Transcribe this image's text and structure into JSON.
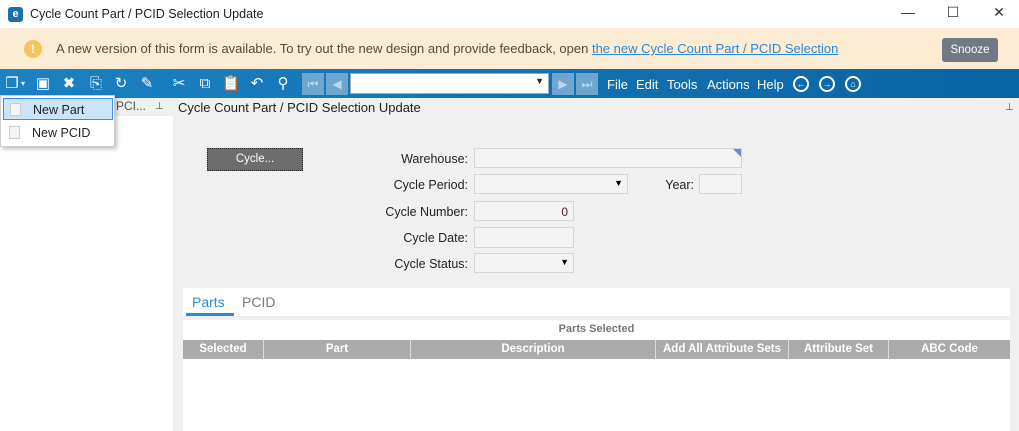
{
  "window": {
    "title": "Cycle Count Part / PCID Selection Update",
    "logo": "e",
    "minimize": "—",
    "maximize": "☐",
    "close": "✕"
  },
  "banner": {
    "text": "A new version of this form is available. To try out the new design and provide feedback, open ",
    "link": "the new Cycle Count Part / PCID Selection",
    "snooze": "Snooze"
  },
  "toolbar": {
    "menus": [
      "File",
      "Edit",
      "Tools",
      "Actions",
      "Help"
    ]
  },
  "dropdown": {
    "items": [
      "New Part",
      "New PCID"
    ]
  },
  "left_panel": {
    "title": "PCI..."
  },
  "form": {
    "title": "Cycle Count Part / PCID Selection Update",
    "cycle_button": "Cycle...",
    "warehouse_label": "Warehouse:",
    "warehouse": "",
    "cycle_period_label": "Cycle Period:",
    "cycle_period": "",
    "year_label": "Year:",
    "year": "",
    "cycle_number_label": "Cycle Number:",
    "cycle_number": "0",
    "cycle_date_label": "Cycle Date:",
    "cycle_date": "",
    "cycle_status_label": "Cycle Status:",
    "cycle_status": ""
  },
  "tabs": [
    "Parts",
    "PCID"
  ],
  "grid": {
    "caption": "Parts Selected",
    "columns": [
      "Selected",
      "Part",
      "Description",
      "Add All Attribute Sets",
      "Attribute Set",
      "ABC Code"
    ]
  },
  "colors": {
    "toolbar": "#1b82c4",
    "accent": "#2a8ad6",
    "banner": "#fcecd3"
  }
}
